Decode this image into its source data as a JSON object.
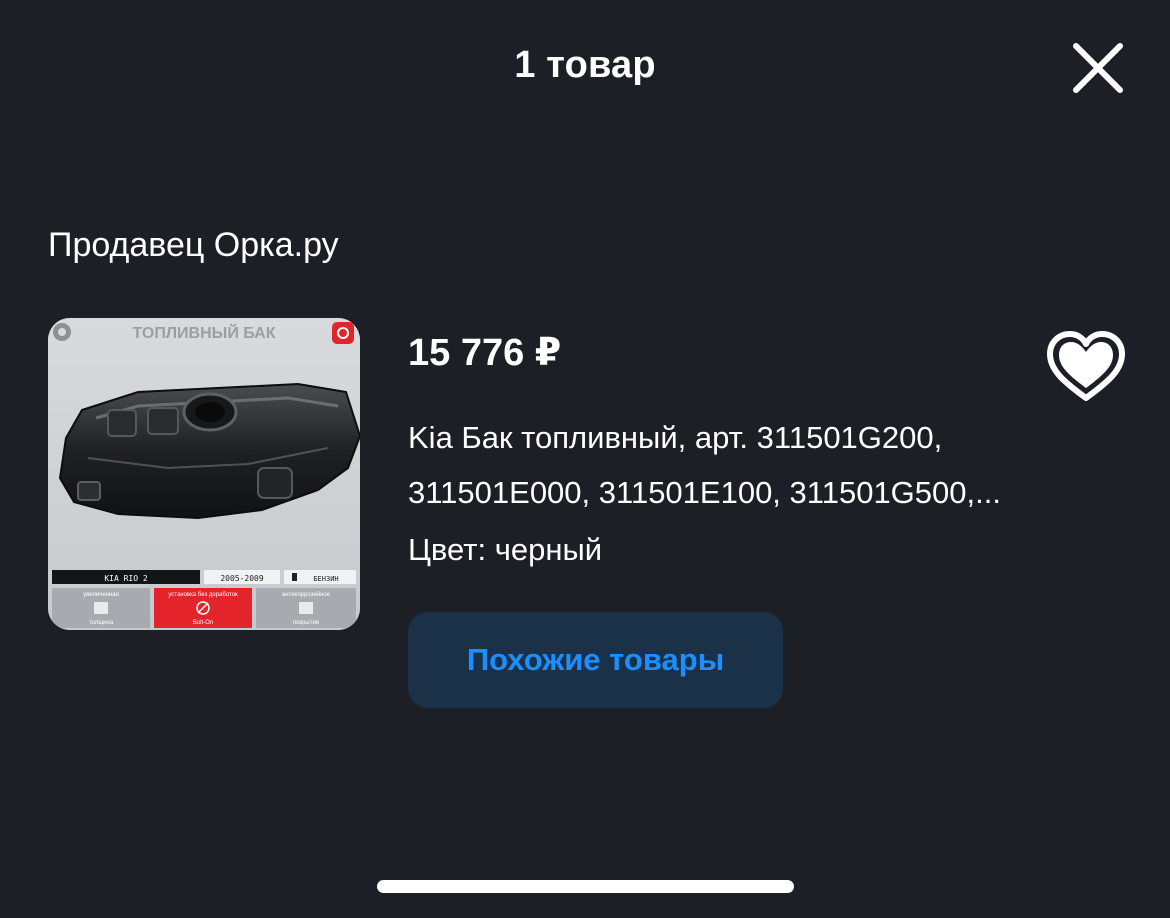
{
  "header": {
    "title": "1 товар",
    "close_icon": "close-icon"
  },
  "seller": {
    "label": "Продавец Орка.ру"
  },
  "product": {
    "image": {
      "title_text": "ТОПЛИВНЫЙ БАК",
      "model_badge": "KIA RIO 2",
      "years_badge": "2005-2009",
      "fuel_badge": "БЕНЗИН",
      "feature_1_top": "увеличенная",
      "feature_1_bottom": "толщина",
      "feature_2_top": "установка без доработок",
      "feature_2_bottom": "Bolt-On",
      "feature_3_top": "антикоррозийное",
      "feature_3_bottom": "покрытие"
    },
    "price": "15 776 ₽",
    "title": "Kia Бак топливный, арт. 311501G200, 311501E000, 311501E100, 311501G500,...",
    "color_label": "Цвет:",
    "color_value": "черный",
    "favorite_icon": "heart-icon"
  },
  "actions": {
    "similar_label": "Похожие товары"
  },
  "colors": {
    "background": "#1c1f25",
    "button_bg": "#1b3147",
    "accent": "#1a8fff",
    "text": "#ffffff"
  }
}
